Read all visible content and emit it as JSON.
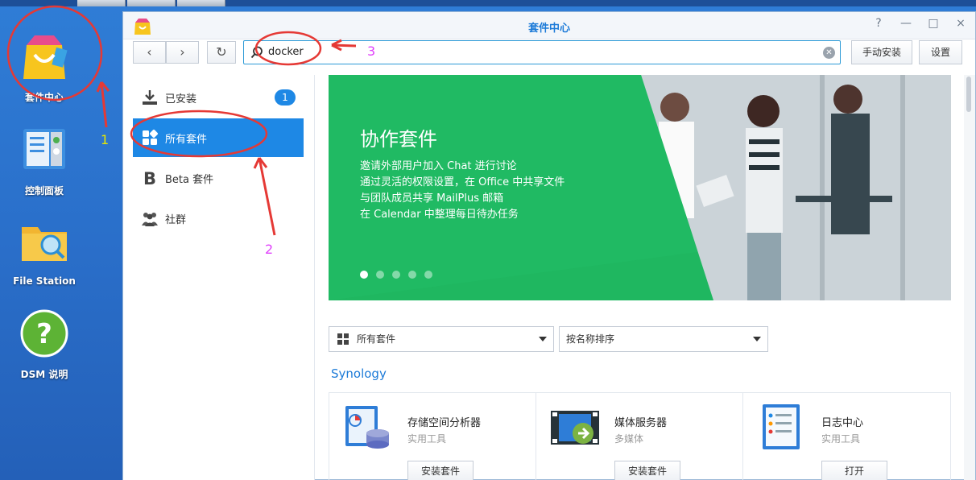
{
  "desktop": {
    "icons": [
      {
        "label": "套件中心",
        "icon": "package-center-icon"
      },
      {
        "label": "控制面板",
        "icon": "control-panel-icon"
      },
      {
        "label": "File Station",
        "icon": "file-station-icon"
      },
      {
        "label": "DSM 说明",
        "icon": "help-icon"
      }
    ]
  },
  "window": {
    "title": "套件中心",
    "controls": [
      "?",
      "—",
      "□",
      "×"
    ]
  },
  "toolbar": {
    "search_value": "docker",
    "manual_install_label": "手动安装",
    "settings_label": "设置"
  },
  "sidebar": {
    "items": [
      {
        "label": "已安装",
        "badge": "1",
        "icon": "download-icon"
      },
      {
        "label": "所有套件",
        "icon": "grid-icon",
        "active": true
      },
      {
        "label": "Beta 套件",
        "icon": "beta-icon"
      },
      {
        "label": "社群",
        "icon": "community-icon"
      }
    ]
  },
  "banner": {
    "title": "协作套件",
    "lines": [
      "邀请外部用户加入 Chat 进行讨论",
      "通过灵活的权限设置，在 Office 中共享文件",
      "与团队成员共享 MailPlus 邮箱",
      "在 Calendar 中整理每日待办任务"
    ],
    "slide_count": 5,
    "active_slide": 0
  },
  "filters": {
    "category_label": "所有套件",
    "sort_label": "按名称排序"
  },
  "section": {
    "title": "Synology"
  },
  "packages": [
    {
      "name": "存储空间分析器",
      "category": "实用工具",
      "button": "安装套件"
    },
    {
      "name": "媒体服务器",
      "category": "多媒体",
      "button": "安装套件"
    },
    {
      "name": "日志中心",
      "category": "实用工具",
      "button": "打开"
    }
  ],
  "annotations": [
    "1",
    "2",
    "3"
  ],
  "colors": {
    "accent": "#1e88e5",
    "annotation": "#e53935",
    "number": "#e040fb",
    "number_yellow": "#e6e600"
  }
}
